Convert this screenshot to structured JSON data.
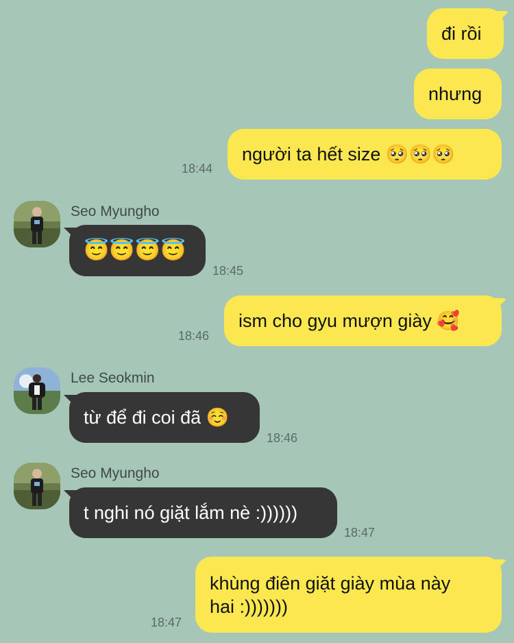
{
  "messages": [
    {
      "text": "đi rồi"
    },
    {
      "text": "nhưng"
    },
    {
      "text": "người ta hết size 🥺🥺🥺",
      "time": "18:44"
    },
    {
      "sender": "Seo Myungho",
      "text": "😇😇😇😇",
      "time": "18:45"
    },
    {
      "text": "ism cho gyu mượn giày 🥰",
      "time": "18:46"
    },
    {
      "sender": "Lee Seokmin",
      "text": "từ để đi coi đã ☺️",
      "time": "18:46"
    },
    {
      "sender": "Seo Myungho",
      "text": "t nghi nó giặt lắm nè :))))))",
      "time": "18:47"
    },
    {
      "text_line1": "khùng điên giặt giày mùa này",
      "text_line2": "hai :)))))))",
      "time": "18:47"
    }
  ],
  "colors": {
    "background": "#a6c6b8",
    "outgoing_bubble": "#fbe74f",
    "incoming_bubble": "#363636"
  }
}
